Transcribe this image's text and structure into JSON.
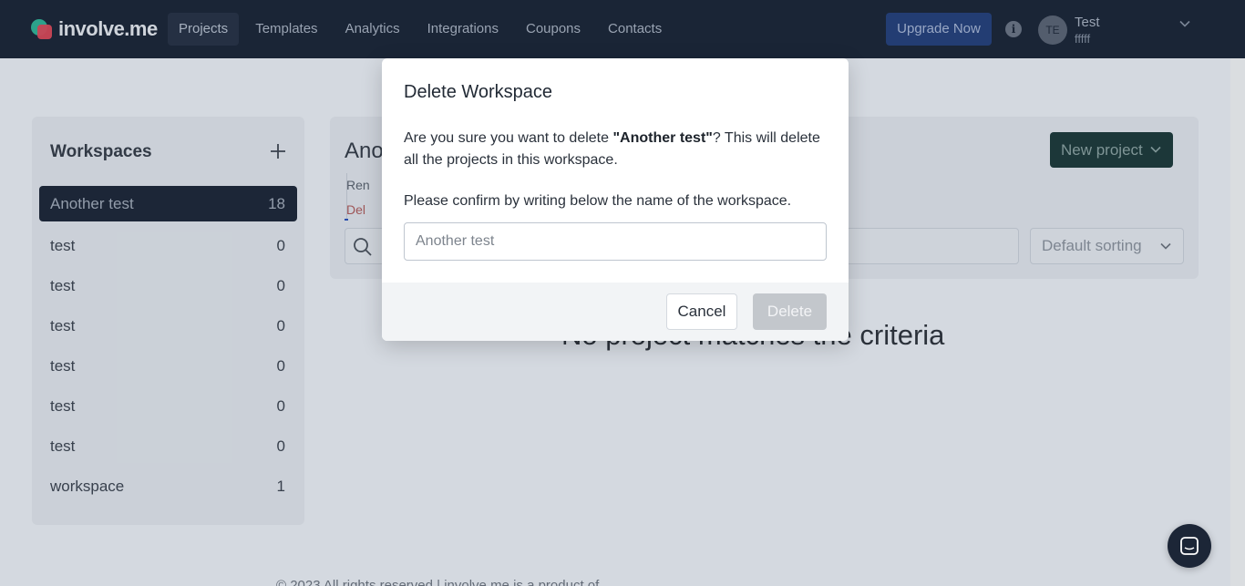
{
  "app": {
    "logo_text": "involve.me"
  },
  "nav": {
    "items": [
      {
        "label": "Projects",
        "active": true
      },
      {
        "label": "Templates"
      },
      {
        "label": "Analytics"
      },
      {
        "label": "Integrations"
      },
      {
        "label": "Coupons"
      },
      {
        "label": "Contacts"
      }
    ],
    "upgrade_label": "Upgrade Now",
    "user": {
      "initials": "TE",
      "name": "Test",
      "subtitle": "fffff"
    }
  },
  "sidebar": {
    "title": "Workspaces",
    "items": [
      {
        "label": "Another test",
        "count": "18",
        "active": true
      },
      {
        "label": "test",
        "count": "0"
      },
      {
        "label": "test",
        "count": "0"
      },
      {
        "label": "test",
        "count": "0"
      },
      {
        "label": "test",
        "count": "0"
      },
      {
        "label": "test",
        "count": "0"
      },
      {
        "label": "test",
        "count": "0"
      },
      {
        "label": "workspace",
        "count": "1"
      }
    ]
  },
  "main": {
    "title": "Ano",
    "new_project_label": "New project",
    "rename_label": "Ren",
    "delete_label": "Del",
    "sort_label": "Default sorting",
    "empty_message": "No project matches the criteria",
    "footer": "© 2023 All rights reserved | involve.me is a product of ..."
  },
  "modal": {
    "title": "Delete Workspace",
    "body_prefix": "Are you sure you want to delete ",
    "workspace_name": "\"Another test\"",
    "body_suffix": "? This will delete all the projects in this workspace.",
    "confirm_text": "Please confirm by writing below the name of the workspace.",
    "input_placeholder": "Another test",
    "input_value": "",
    "cancel_label": "Cancel",
    "delete_label": "Delete"
  },
  "colors": {
    "nav_bg": "#1a2536",
    "upgrade_bg": "#24407c",
    "active_workspace_bg": "#1c2637",
    "new_project_bg": "#1c3a3a",
    "delete_disabled_bg": "#c3c7cc"
  },
  "icons": {
    "info": "info-icon",
    "chevron": "chevron-down-icon",
    "add": "plus-icon",
    "search": "search-icon",
    "chat": "chat-icon"
  }
}
